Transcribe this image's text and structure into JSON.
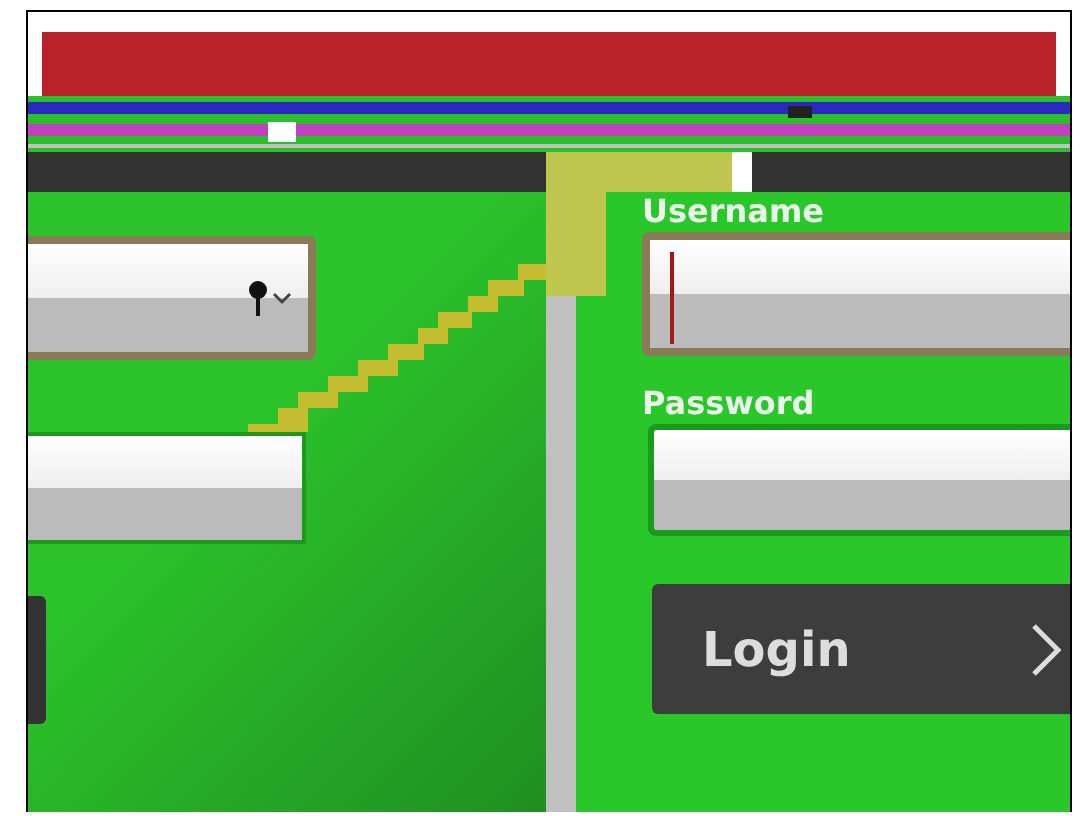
{
  "left_panel": {
    "select_field": {
      "has_location_pin": true
    }
  },
  "login_form": {
    "fields": [
      {
        "label": "Username",
        "focused": true
      },
      {
        "label": "Password",
        "focused": false
      }
    ],
    "submit_button": {
      "label": "Login"
    }
  }
}
